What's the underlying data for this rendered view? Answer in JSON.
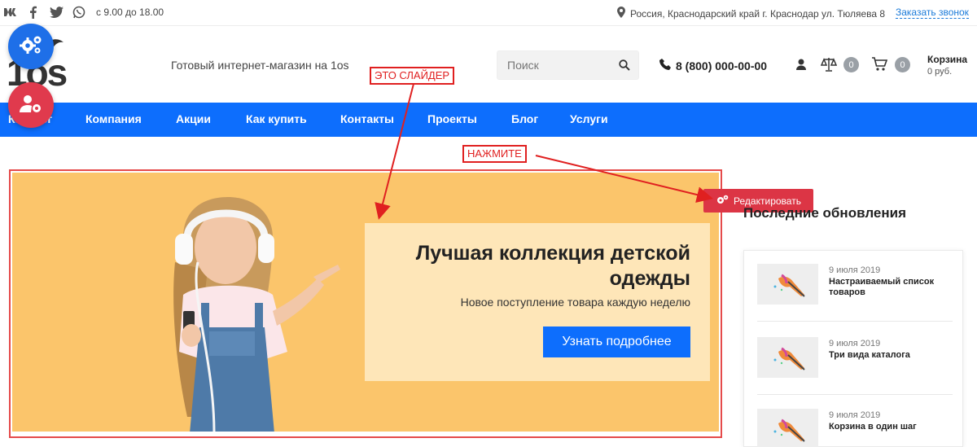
{
  "topbar": {
    "social": [
      "vk-icon",
      "facebook-icon",
      "twitter-icon",
      "whatsapp-icon"
    ],
    "hours": "с 9.00 до 18.00",
    "address": "Россия, Краснодарский край г. Краснодар ул. Тюляева 8",
    "callback": "Заказать звонок"
  },
  "header": {
    "logo_text": "1os",
    "tagline": "Готовый интернет-магазин на 1os",
    "search_placeholder": "Поиск",
    "phone": "8 (800) 000-00-00",
    "compare_count": "0",
    "cart_count": "0",
    "cart_title": "Корзина",
    "cart_sum": "0 руб."
  },
  "nav": {
    "items": [
      "Каталог",
      "Компания",
      "Акции",
      "Как купить",
      "Контакты",
      "Проекты",
      "Блог",
      "Услуги"
    ]
  },
  "annotations": {
    "slider_label": "ЭТО СЛАЙДЕР",
    "click_label": "НАЖМИТЕ"
  },
  "slider": {
    "title": "Лучшая коллекция детской одежды",
    "subtitle": "Новое поступление товара каждую неделю",
    "button": "Узнать подробнее"
  },
  "edit_button": "Редактировать",
  "sidebar": {
    "title": "Последние обновления",
    "news": [
      {
        "date": "9 июля 2019",
        "title": "Настраиваемый список товаров"
      },
      {
        "date": "9 июля 2019",
        "title": "Три вида каталога"
      },
      {
        "date": "9 июля 2019",
        "title": "Корзина в один шаг"
      }
    ]
  },
  "colors": {
    "primary": "#0d6efd",
    "danger": "#dc3545",
    "slider_bg": "#fbc56b",
    "annotation": "#e02020"
  }
}
